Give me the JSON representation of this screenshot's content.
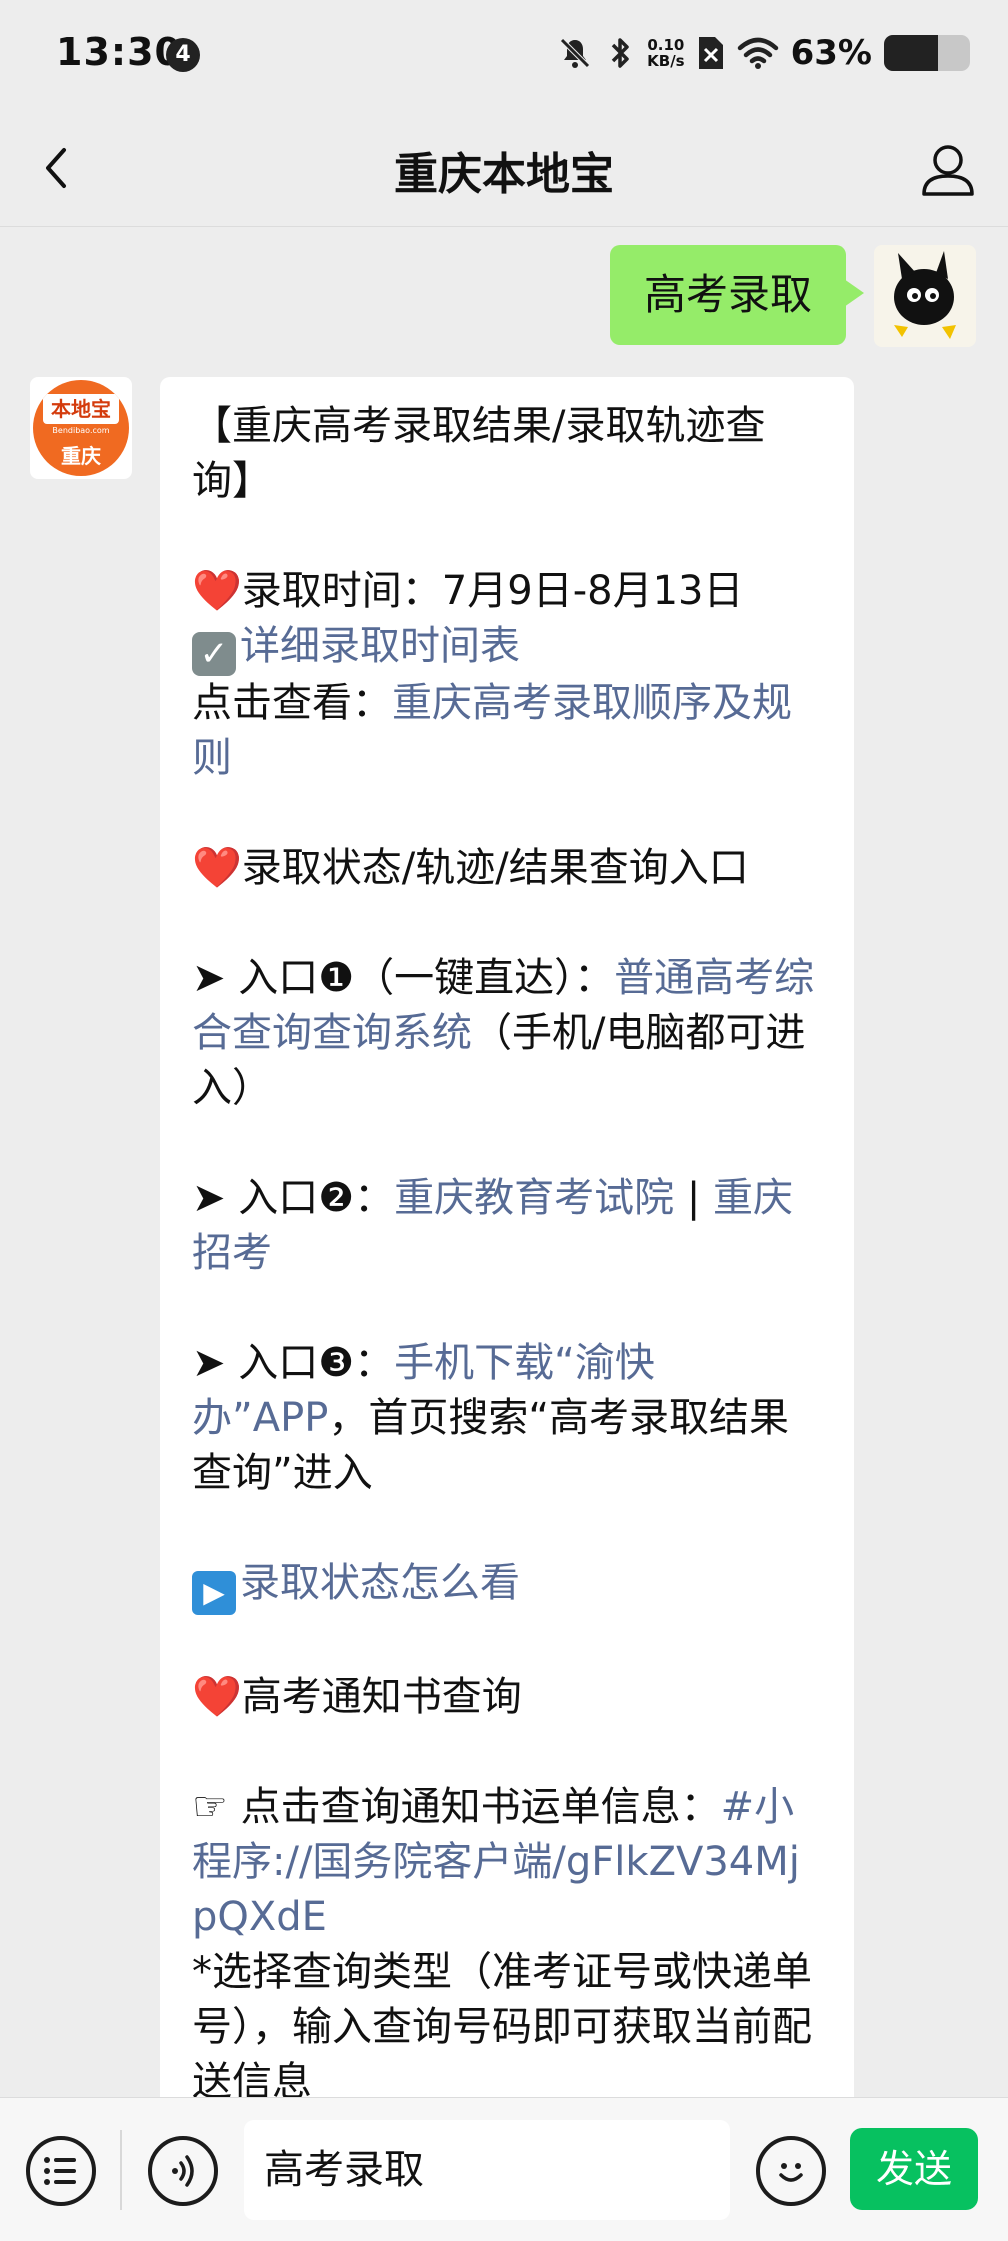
{
  "status_bar": {
    "time": "13:30",
    "notification_count": "4",
    "net_speed_top": "0.10",
    "net_speed_bottom": "KB/s",
    "battery_percent": "63%",
    "battery_level": 0.63
  },
  "nav": {
    "title": "重庆本地宝"
  },
  "chat": {
    "outgoing_message": "高考录取",
    "bot_logo": {
      "top": "本地宝",
      "mid": "Bendibao.com",
      "bottom": "重庆"
    },
    "reply": {
      "title": "【重庆高考录取结果/录取轨迹查询】",
      "time_line": "❤️录取时间：7月9日-8月13日",
      "schedule_link": "详细录取时间表",
      "order_prefix": "点击查看：",
      "order_link": "重庆高考录取顺序及规则",
      "status_heading": "❤️录取状态/轨迹/结果查询入口",
      "entry1_prefix": "➤ 入口❶（一键直达）：",
      "entry1_link": "普通高考综合查询查询系统",
      "entry1_suffix": "（手机/电脑都可进入）",
      "entry2_prefix": "➤ 入口❷：",
      "entry2_link1": "重庆教育考试院",
      "entry2_sep": "|",
      "entry2_link2": "重庆招考",
      "entry3_prefix": "➤ 入口❸：",
      "entry3_link": "手机下载“渝快办”APP",
      "entry3_suffix": "，首页搜索“高考录取结果查询”进入",
      "status_view_link": "录取状态怎么看",
      "notice_heading": "❤️高考通知书查询",
      "notice_prefix": "☞ 点击查询通知书运单信息：",
      "notice_link": "#小程序://国务院客户端/gFlkZV34MjpQXdE",
      "notice_tip": "*选择查询类型（准考证号或快递单号），输入查询号码即可获取当前配送信息"
    }
  },
  "input_bar": {
    "input_value": "高考录取",
    "send_label": "发送"
  },
  "colors": {
    "outgoing_bubble": "#95ec69",
    "link": "#576b95",
    "send_button": "#07c160"
  }
}
